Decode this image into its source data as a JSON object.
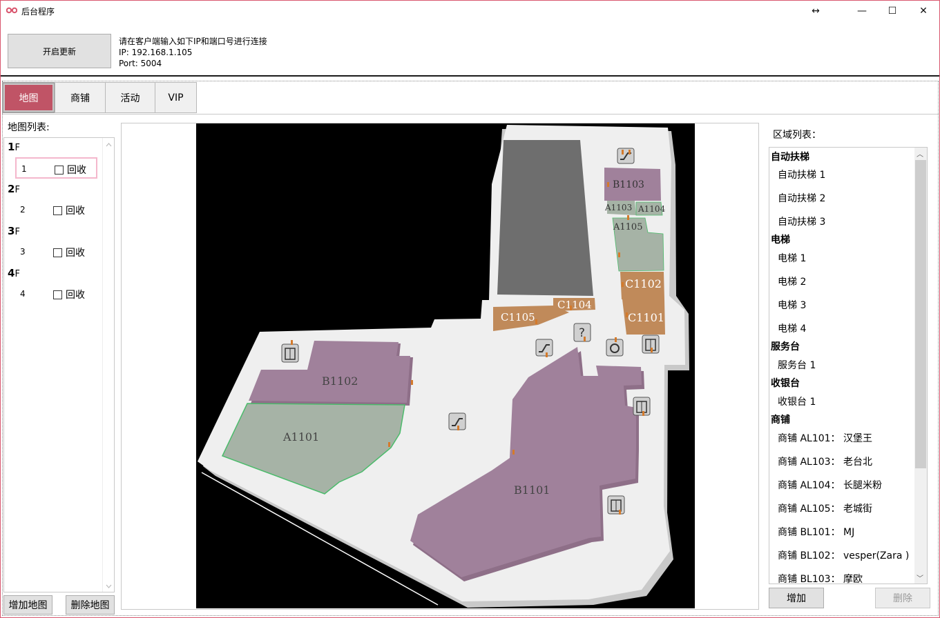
{
  "window": {
    "title": "后台程序",
    "resize_glyph": "↔",
    "minimize_glyph": "—",
    "maximize_glyph": "☐",
    "close_glyph": "✕"
  },
  "header": {
    "update_button": "开启更新",
    "info_line1": "请在客户端输入如下IP和端口号进行连接",
    "info_line2": "IP:  192.168.1.105",
    "info_line3": "Port: 5004"
  },
  "tabs": [
    {
      "label": "地图",
      "active": true
    },
    {
      "label": "商铺",
      "active": false
    },
    {
      "label": "活动",
      "active": false
    },
    {
      "label": "VIP",
      "active": false
    }
  ],
  "map_panel": {
    "label": "地图列表:",
    "floors": [
      {
        "number": "1",
        "suffix": "F",
        "row_num": "1",
        "checkbox": "回收",
        "selected": true
      },
      {
        "number": "2",
        "suffix": "F",
        "row_num": "2",
        "checkbox": "回收",
        "selected": false
      },
      {
        "number": "3",
        "suffix": "F",
        "row_num": "3",
        "checkbox": "回收",
        "selected": false
      },
      {
        "number": "4",
        "suffix": "F",
        "row_num": "4",
        "checkbox": "回收",
        "selected": false
      }
    ],
    "add_button": "增加地图",
    "delete_button": "删除地图"
  },
  "map": {
    "shops": {
      "b1103": "B1103",
      "a1103": "A1103",
      "a1104": "A1104",
      "a1105": "A1105",
      "c1102": "C1102",
      "c1101": "C1101",
      "c1104": "C1104",
      "c1105": "C1105",
      "b1102": "B1102",
      "a1101": "A1101",
      "b1101": "B1101"
    },
    "info_glyph": "?",
    "colors": {
      "purple": "#a0819b",
      "green": "#a6b3a6",
      "orange": "#c08a5a",
      "gray": "#6e6e6e",
      "floor": "#efefef",
      "shadow": "#c9c9c9"
    }
  },
  "region_panel": {
    "label": "区域列表：",
    "groups": [
      {
        "name": "自动扶梯",
        "items": [
          "自动扶梯 1",
          "自动扶梯 2",
          "自动扶梯 3"
        ]
      },
      {
        "name": "电梯",
        "items": [
          "电梯 1",
          "电梯 2",
          "电梯 3",
          "电梯 4"
        ]
      },
      {
        "name": "服务台",
        "items": [
          "服务台 1"
        ]
      },
      {
        "name": "收银台",
        "items": [
          "收银台 1"
        ]
      },
      {
        "name": "商铺",
        "items": [
          "商铺 AL101：  汉堡王",
          "商铺 AL103：  老台北",
          "商铺 AL104：  长腿米粉",
          "商铺 AL105：  老城街",
          "商铺 BL101：  MJ",
          "商铺 BL102：  vesper(Zara )",
          "商铺 BL103：  摩欧"
        ]
      }
    ],
    "add_button": "增加",
    "delete_button": "删除",
    "scroll_up_glyph": "︿",
    "scroll_down_glyph": "﹀"
  }
}
